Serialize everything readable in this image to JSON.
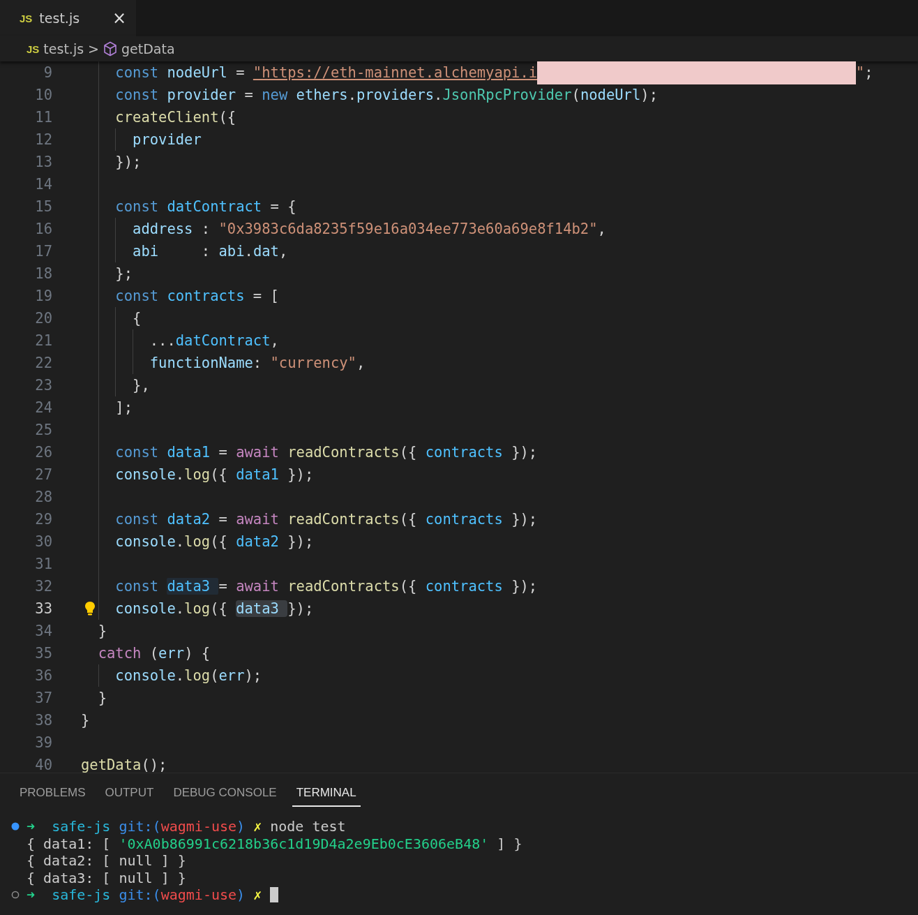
{
  "tabs": [
    {
      "icon_text": "JS",
      "label": "test.js",
      "selected": true,
      "close": "×"
    }
  ],
  "breadcrumb": {
    "file_icon_text": "JS",
    "file": "test.js",
    "separator": ">",
    "symbol": "getData"
  },
  "editor": {
    "lines": [
      {
        "number": "9",
        "current": false,
        "tokens": [
          {
            "text": "    const ",
            "kind": "keyword"
          },
          {
            "text": "nodeUrl",
            "kind": "variable"
          },
          {
            "text": " = ",
            "kind": "plain"
          },
          {
            "text": "\"https://eth-mainnet.alchemyapi.i",
            "kind": "link"
          },
          {
            "kind": "redaction"
          },
          {
            "text": "\"",
            "kind": "string"
          },
          {
            "text": ";",
            "kind": "plain"
          }
        ]
      },
      {
        "number": "10",
        "current": false,
        "tokens": [
          {
            "text": "    const ",
            "kind": "keyword"
          },
          {
            "text": "provider",
            "kind": "variable"
          },
          {
            "text": " = ",
            "kind": "plain"
          },
          {
            "text": "new ",
            "kind": "keyword"
          },
          {
            "text": "ethers",
            "kind": "variable"
          },
          {
            "text": ".",
            "kind": "plain"
          },
          {
            "text": "providers",
            "kind": "variable"
          },
          {
            "text": ".",
            "kind": "plain"
          },
          {
            "text": "JsonRpcProvider",
            "kind": "class"
          },
          {
            "text": "(",
            "kind": "plain"
          },
          {
            "text": "nodeUrl",
            "kind": "variable"
          },
          {
            "text": ");",
            "kind": "plain"
          }
        ]
      },
      {
        "number": "11",
        "current": false,
        "tokens": [
          {
            "text": "    createClient",
            "kind": "function"
          },
          {
            "text": "({",
            "kind": "plain"
          }
        ]
      },
      {
        "number": "12",
        "current": false,
        "tokens": [
          {
            "text": "      provider",
            "kind": "variable"
          }
        ]
      },
      {
        "number": "13",
        "current": false,
        "tokens": [
          {
            "text": "    });",
            "kind": "plain"
          }
        ]
      },
      {
        "number": "14",
        "current": false
      },
      {
        "number": "15",
        "current": false,
        "tokens": [
          {
            "text": "    const ",
            "kind": "keyword"
          },
          {
            "text": "datContract",
            "kind": "constant"
          },
          {
            "text": " = {",
            "kind": "plain"
          }
        ]
      },
      {
        "number": "16",
        "current": false,
        "tokens": [
          {
            "text": "      address",
            "kind": "variable"
          },
          {
            "text": " : ",
            "kind": "plain"
          },
          {
            "text": "\"0x3983c6da8235f59e16a034ee773e60a69e8f14b2\"",
            "kind": "string"
          },
          {
            "text": ",",
            "kind": "plain"
          }
        ]
      },
      {
        "number": "17",
        "current": false,
        "tokens": [
          {
            "text": "      abi",
            "kind": "variable"
          },
          {
            "text": "     : ",
            "kind": "plain"
          },
          {
            "text": "abi",
            "kind": "variable"
          },
          {
            "text": ".",
            "kind": "plain"
          },
          {
            "text": "dat",
            "kind": "variable"
          },
          {
            "text": ",",
            "kind": "plain"
          }
        ]
      },
      {
        "number": "18",
        "current": false,
        "tokens": [
          {
            "text": "    };",
            "kind": "plain"
          }
        ]
      },
      {
        "number": "19",
        "current": false,
        "tokens": [
          {
            "text": "    const ",
            "kind": "keyword"
          },
          {
            "text": "contracts",
            "kind": "constant"
          },
          {
            "text": " = [",
            "kind": "plain"
          }
        ]
      },
      {
        "number": "20",
        "current": false,
        "tokens": [
          {
            "text": "      {",
            "kind": "plain"
          }
        ]
      },
      {
        "number": "21",
        "current": false,
        "tokens": [
          {
            "text": "        ...",
            "kind": "plain"
          },
          {
            "text": "datContract",
            "kind": "constant"
          },
          {
            "text": ",",
            "kind": "plain"
          }
        ]
      },
      {
        "number": "22",
        "current": false,
        "tokens": [
          {
            "text": "        functionName",
            "kind": "variable"
          },
          {
            "text": ": ",
            "kind": "plain"
          },
          {
            "text": "\"currency\"",
            "kind": "string"
          },
          {
            "text": ",",
            "kind": "plain"
          }
        ]
      },
      {
        "number": "23",
        "current": false,
        "tokens": [
          {
            "text": "      },",
            "kind": "plain"
          }
        ]
      },
      {
        "number": "24",
        "current": false,
        "tokens": [
          {
            "text": "    ];",
            "kind": "plain"
          }
        ]
      },
      {
        "number": "25",
        "current": false
      },
      {
        "number": "26",
        "current": false,
        "tokens": [
          {
            "text": "    const ",
            "kind": "keyword"
          },
          {
            "text": "data1",
            "kind": "constant"
          },
          {
            "text": " = ",
            "kind": "plain"
          },
          {
            "text": "await ",
            "kind": "control"
          },
          {
            "text": "readContracts",
            "kind": "function"
          },
          {
            "text": "({ ",
            "kind": "plain"
          },
          {
            "text": "contracts",
            "kind": "constant"
          },
          {
            "text": " });",
            "kind": "plain"
          }
        ]
      },
      {
        "number": "27",
        "current": false,
        "tokens": [
          {
            "text": "    console",
            "kind": "variable"
          },
          {
            "text": ".",
            "kind": "plain"
          },
          {
            "text": "log",
            "kind": "function"
          },
          {
            "text": "({ ",
            "kind": "plain"
          },
          {
            "text": "data1",
            "kind": "constant"
          },
          {
            "text": " });",
            "kind": "plain"
          }
        ]
      },
      {
        "number": "28",
        "current": false
      },
      {
        "number": "29",
        "current": false,
        "tokens": [
          {
            "text": "    const ",
            "kind": "keyword"
          },
          {
            "text": "data2",
            "kind": "constant"
          },
          {
            "text": " = ",
            "kind": "plain"
          },
          {
            "text": "await ",
            "kind": "control"
          },
          {
            "text": "readContracts",
            "kind": "function"
          },
          {
            "text": "({ ",
            "kind": "plain"
          },
          {
            "text": "contracts",
            "kind": "constant"
          },
          {
            "text": " });",
            "kind": "plain"
          }
        ]
      },
      {
        "number": "30",
        "current": false,
        "tokens": [
          {
            "text": "    console",
            "kind": "variable"
          },
          {
            "text": ".",
            "kind": "plain"
          },
          {
            "text": "log",
            "kind": "function"
          },
          {
            "text": "({ ",
            "kind": "plain"
          },
          {
            "text": "data2",
            "kind": "constant"
          },
          {
            "text": " });",
            "kind": "plain"
          }
        ]
      },
      {
        "number": "31",
        "current": false
      },
      {
        "number": "32",
        "current": false,
        "tokens": [
          {
            "text": "    const ",
            "kind": "keyword"
          },
          {
            "text": "data3 ",
            "kind": "highlight"
          },
          {
            "text": "= ",
            "kind": "plain"
          },
          {
            "text": "await ",
            "kind": "control"
          },
          {
            "text": "readContracts",
            "kind": "function"
          },
          {
            "text": "({ ",
            "kind": "plain"
          },
          {
            "text": "contracts",
            "kind": "constant"
          },
          {
            "text": " });",
            "kind": "plain"
          }
        ]
      },
      {
        "number": "33",
        "current": true,
        "tokens": [
          {
            "text": "    console",
            "kind": "variable"
          },
          {
            "text": ".",
            "kind": "plain"
          },
          {
            "text": "log",
            "kind": "function"
          },
          {
            "text": "({ ",
            "kind": "plain"
          },
          {
            "text": "data3 ",
            "kind": "selection"
          },
          {
            "text": "});",
            "kind": "plain"
          }
        ]
      },
      {
        "number": "34",
        "current": false,
        "tokens": [
          {
            "text": "  }",
            "kind": "plain"
          }
        ]
      },
      {
        "number": "35",
        "current": false,
        "tokens": [
          {
            "text": "  catch ",
            "kind": "control"
          },
          {
            "text": "(",
            "kind": "plain"
          },
          {
            "text": "err",
            "kind": "variable"
          },
          {
            "text": ") {",
            "kind": "plain"
          }
        ]
      },
      {
        "number": "36",
        "current": false,
        "tokens": [
          {
            "text": "    console",
            "kind": "variable"
          },
          {
            "text": ".",
            "kind": "plain"
          },
          {
            "text": "log",
            "kind": "function"
          },
          {
            "text": "(",
            "kind": "plain"
          },
          {
            "text": "err",
            "kind": "variable"
          },
          {
            "text": ");",
            "kind": "plain"
          }
        ]
      },
      {
        "number": "37",
        "current": false,
        "tokens": [
          {
            "text": "  }",
            "kind": "plain"
          }
        ]
      },
      {
        "number": "38",
        "current": false,
        "tokens": [
          {
            "text": "}",
            "kind": "plain"
          }
        ]
      },
      {
        "number": "39",
        "current": false
      },
      {
        "number": "40",
        "current": false,
        "tokens": [
          {
            "text": "getData",
            "kind": "function"
          },
          {
            "text": "();",
            "kind": "plain"
          }
        ]
      }
    ]
  },
  "panel": {
    "tabs": [
      {
        "label": "PROBLEMS",
        "selected": false
      },
      {
        "label": "OUTPUT",
        "selected": false
      },
      {
        "label": "DEBUG CONSOLE",
        "selected": false
      },
      {
        "label": "TERMINAL",
        "selected": true
      }
    ],
    "terminal": [
      {
        "kind": "prompt-active",
        "tokens": [
          {
            "text": "➜  ",
            "kind": "arrow"
          },
          {
            "text": "safe-js ",
            "kind": "dir"
          },
          {
            "text": "git:(",
            "kind": "git"
          },
          {
            "text": "wagmi-use",
            "kind": "branch"
          },
          {
            "text": ") ",
            "kind": "git"
          },
          {
            "text": "✗ ",
            "kind": "dirty"
          },
          {
            "text": "node test",
            "kind": "plain"
          }
        ]
      },
      {
        "kind": "output",
        "tokens": [
          {
            "text": "{ data1: [ ",
            "kind": "plain"
          },
          {
            "text": "'0xA0b86991c6218b36c1d19D4a2e9Eb0cE3606eB48'",
            "kind": "str"
          },
          {
            "text": " ] }",
            "kind": "plain"
          }
        ]
      },
      {
        "kind": "output",
        "tokens": [
          {
            "text": "{ data2: [ null ] }",
            "kind": "plain"
          }
        ]
      },
      {
        "kind": "output",
        "tokens": [
          {
            "text": "{ data3: [ null ] }",
            "kind": "plain"
          }
        ]
      },
      {
        "kind": "prompt-idle",
        "tokens": [
          {
            "text": "➜  ",
            "kind": "arrow"
          },
          {
            "text": "safe-js ",
            "kind": "dir"
          },
          {
            "text": "git:(",
            "kind": "git"
          },
          {
            "text": "wagmi-use",
            "kind": "branch"
          },
          {
            "text": ") ",
            "kind": "git"
          },
          {
            "text": "✗ ",
            "kind": "dirty"
          },
          {
            "kind": "cursor"
          }
        ]
      }
    ]
  }
}
